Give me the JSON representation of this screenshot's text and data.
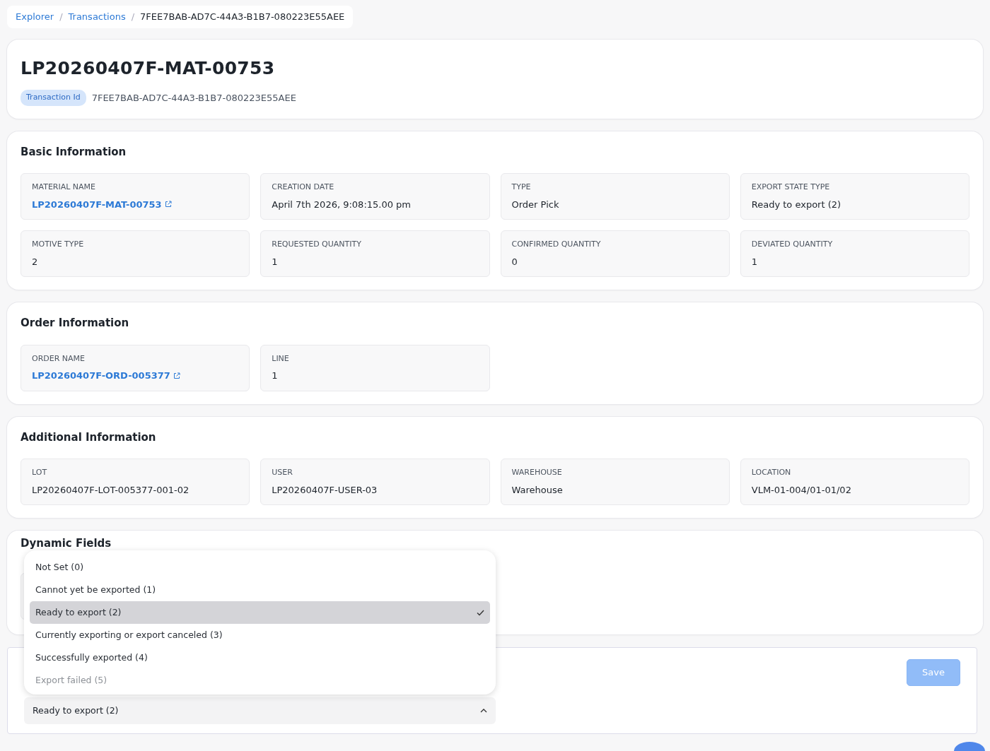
{
  "breadcrumb": [
    {
      "label": "Explorer",
      "kind": "link"
    },
    {
      "label": "/",
      "kind": "separator"
    },
    {
      "label": "Transactions",
      "kind": "link"
    },
    {
      "label": "/",
      "kind": "separator"
    },
    {
      "label": "7FEE7BAB-AD7C-44A3-B1B7-080223E55AEE",
      "kind": "current"
    }
  ],
  "header": {
    "title": "LP20260407F-MAT-00753",
    "badge": "Transaction Id",
    "transaction_id": "7FEE7BAB-AD7C-44A3-B1B7-080223E55AEE"
  },
  "sections": [
    {
      "title": "Basic Information",
      "fields": [
        {
          "label": "MATERIAL NAME",
          "value": "LP20260407F-MAT-00753",
          "kind": "link"
        },
        {
          "label": "CREATION DATE",
          "value": "April 7th 2026, 9:08:15.00 pm",
          "kind": "text"
        },
        {
          "label": "TYPE",
          "value": "Order Pick",
          "kind": "text"
        },
        {
          "label": "EXPORT STATE TYPE",
          "value": "Ready to export (2)",
          "kind": "text"
        },
        {
          "label": "MOTIVE TYPE",
          "value": "2",
          "kind": "text"
        },
        {
          "label": "REQUESTED QUANTITY",
          "value": "1",
          "kind": "text"
        },
        {
          "label": "CONFIRMED QUANTITY",
          "value": "0",
          "kind": "text"
        },
        {
          "label": "DEVIATED QUANTITY",
          "value": "1",
          "kind": "text"
        }
      ]
    },
    {
      "title": "Order Information",
      "fields": [
        {
          "label": "ORDER NAME",
          "value": "LP20260407F-ORD-005377",
          "kind": "link"
        },
        {
          "label": "LINE",
          "value": "1",
          "kind": "text"
        }
      ]
    },
    {
      "title": "Additional Information",
      "fields": [
        {
          "label": "LOT",
          "value": "LP20260407F-LOT-005377-001-02",
          "kind": "text"
        },
        {
          "label": "USER",
          "value": "LP20260407F-USER-03",
          "kind": "text"
        },
        {
          "label": "WAREHOUSE",
          "value": "Warehouse",
          "kind": "text"
        },
        {
          "label": "LOCATION",
          "value": "VLM-01-004/01-01/02",
          "kind": "text"
        }
      ]
    }
  ],
  "dynamic_fields": {
    "title": "Dynamic Fields"
  },
  "export_state_select": {
    "value": "Ready to export (2)",
    "expanded": true,
    "options": [
      {
        "label": "Not Set (0)",
        "selected": false
      },
      {
        "label": "Cannot yet be exported (1)",
        "selected": false
      },
      {
        "label": "Ready to export (2)",
        "selected": true
      },
      {
        "label": "Currently exporting or export canceled (3)",
        "selected": false
      },
      {
        "label": "Successfully exported (4)",
        "selected": false
      },
      {
        "label": "Export failed (5)",
        "selected": false
      }
    ]
  },
  "save_button": {
    "label": "Save",
    "disabled": true
  }
}
